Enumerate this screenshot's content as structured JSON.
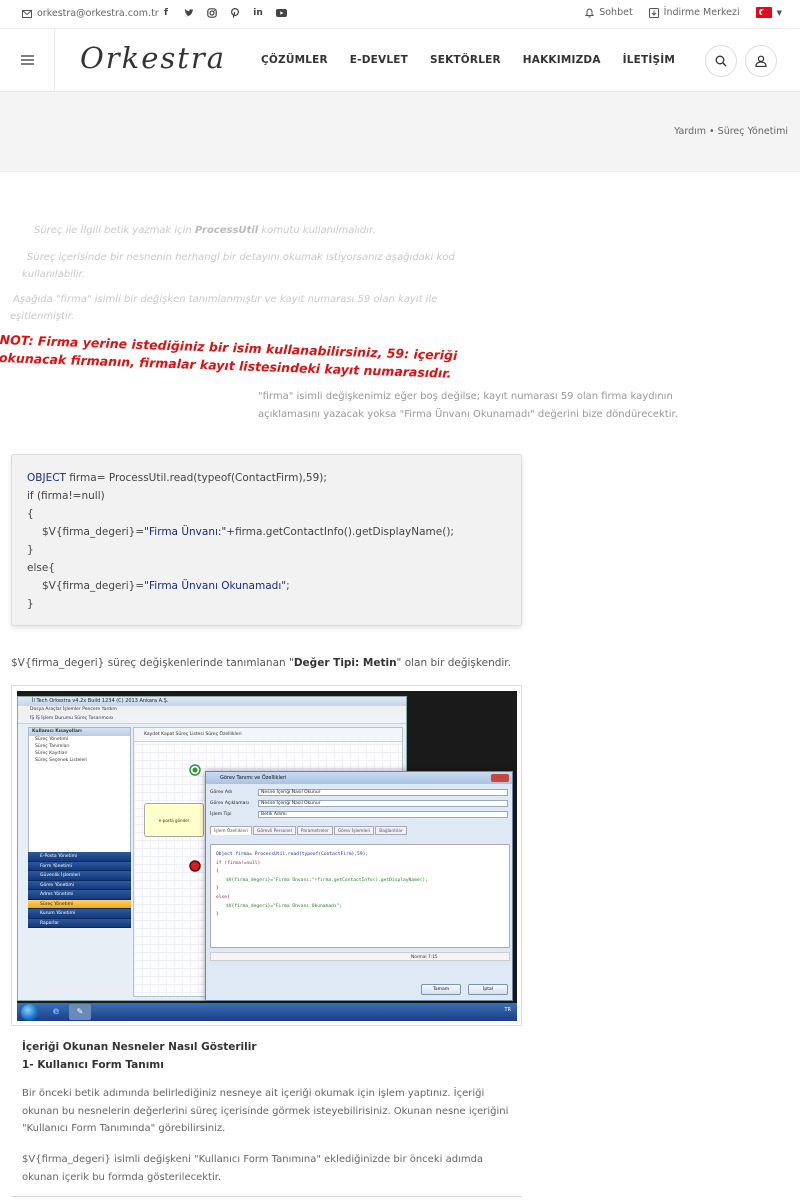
{
  "topbar": {
    "email": "orkestra@orkestra.com.tr",
    "socials": [
      "facebook-icon",
      "twitter-icon",
      "instagram-icon",
      "pinterest-icon",
      "linkedin-icon",
      "youtube-icon"
    ],
    "chat_label": "Sohbet",
    "download_label": "İndirme Merkezi",
    "language": "TR"
  },
  "header": {
    "logo": "Orkestra",
    "nav": [
      "ÇÖZÜMLER",
      "E-DEVLET",
      "SEKTÖRLER",
      "HAKKIMIZDA",
      "İLETİŞİM"
    ]
  },
  "banner": {
    "breadcrumb": "Yardım • Süreç Yönetimi"
  },
  "intro": {
    "line1_pre": "Süreç ile İlgili betik yazmak için ",
    "line1_bold": "ProcessUtil",
    "line1_post": " komutu kullanılmalıdır.",
    "line2": "Süreç içerisinde bir nesnenin herhangi bir detayını okumak istiyorsanız aşağıdaki kod kullanılabilir.",
    "line3": "Aşağıda \"firma\" isimli bir değişken tanımlanmıştır ve kayıt numarası 59 olan kayıt ile eşitlenmiştir."
  },
  "note": "NOT: Firma yerine istediğiniz bir isim kullanabilirsiniz, 59: içeriği okunacak firmanın, firmalar kayıt listesindeki kayıt numarasıdır.",
  "description": "\"firma\" isimli değişkenimiz eğer boş değilse; kayıt numarası 59 olan firma kaydının açıklamasını yazacak yoksa \"Firma Ünvanı Okunamadı\" değerini bize döndürecektir.",
  "code": {
    "l1_kw": "OBJECT",
    "l1_rest": " firma= ProcessUtil.read(typeof(ContactFirm),59);",
    "l2": "if (firma!=null)",
    "l3": "{",
    "l4_pre": "$V{firma_degeri}=",
    "l4_str": "\"Firma Ünvanı:\"",
    "l4_post": "+firma.getContactInfo().getDisplayName();",
    "l5": "}",
    "l6": "else{",
    "l7_pre": "$V{firma_degeri}=",
    "l7_str": "\"Firma Ünvanı Okunamadı\"",
    "l7_post": ";",
    "l8": "}"
  },
  "var_line": {
    "pre": "$V{firma_degeri} süreç değişkenlerinde tanımlanan \"",
    "bold": "Değer Tipi: Metin",
    "post": "\" olan bir değişkendir."
  },
  "screenshot": {
    "app_title": "İl Tech Orkestra v4.2x Build 1234 (C) 2013 Ankara A.Ş.",
    "app_menu": "Dosya   Araçlar   İşlemler   Pencere   Yardım",
    "app_tools": "İŞ İŞ   İşlem Durumu   Süreç Tasarımcısı",
    "left_header": "Kullanıcı Kısayolları",
    "left_sub": "Süreç Yönetimi",
    "left_rows": [
      "Süreç Tanımları",
      "Süreç Kayıtları",
      "Süreç Seçenek Listeleri"
    ],
    "accordion": [
      "E-Posta Yönetimi",
      "Form Yönetimi",
      "Güvenlik İşlemleri",
      "Görev Yönetimi",
      "Adres Yönetimi",
      "Süreç Yönetimi",
      "Kurum Yönetimi",
      "Raporlar"
    ],
    "canvas_tabs": "Kaydet   Kapat   Süreç Listesi   Süreç Özellikleri",
    "task_label": "e-posta gönder",
    "dialog_title": "Görev Tanımı ve Özellikleri",
    "dialog_rows": [
      {
        "label": "Görev Adı",
        "value": "Nesne İçeriği Nasıl Okunur"
      },
      {
        "label": "Görev Açıklaması",
        "value": "Nesne İçeriği Nasıl Okunur"
      },
      {
        "label": "İşlem Tipi",
        "value": "Betik Adımı"
      }
    ],
    "dialog_tabs": [
      "İşlem Özellikleri",
      "Görevli Personel",
      "Parametreler",
      "Görev İşlemleri",
      "Bağlantılar"
    ],
    "code_l1": "Object firma= ProcessUtil.read(typeof(ContactFirm),59);",
    "code_l2": "if (firma!=null)",
    "code_l3": "{",
    "code_l4": "$V{firma_degeri}=\"Firma Ünvanı:\"+firma.getContactInfo().getDisplayName();",
    "code_l5": "}",
    "code_l6": "else{",
    "code_l7": "$V{firma_degeri}=\"Firma Ünvanı Okunamadı\";",
    "code_l8": "}",
    "status": "Normal        7:15",
    "ok_label": "Tamam",
    "cancel_label": "İptal",
    "tray": "TR"
  },
  "section": {
    "title": "İçeriği Okunan Nesneler Nasıl Gösterilir",
    "subtitle": "1- Kullanıcı Form Tanımı",
    "para1": "Bir önceki betik adımında belirlediğiniz nesneye ait içeriği okumak için işlem yaptınız. İçeriği okunan bu nesnelerin değerlerini süreç içerisinde görmek isteyebilirisiniz. Okunan nesne içeriğini \"Kullanıcı Form Tanımında\" görebilirsiniz.",
    "para2": "$V{firma_degeri} isimli değişkeni \"Kullanıcı Form Tanımına\" eklediğinizde bir önceki adımda okunan içerik bu formda gösterilecektir."
  }
}
